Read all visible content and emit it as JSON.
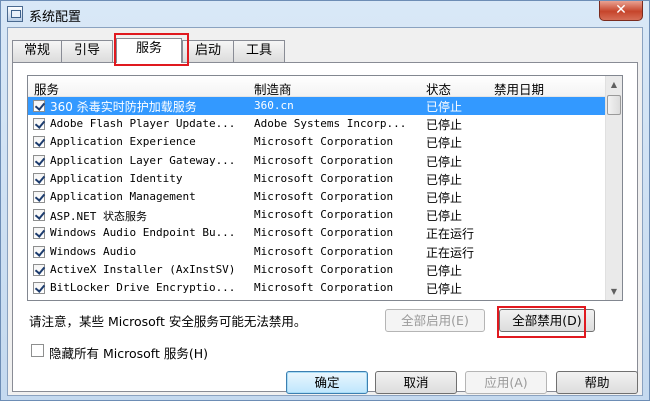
{
  "window": {
    "title": "系统配置",
    "close_symbol": "✕"
  },
  "tabs": [
    {
      "label": "常规"
    },
    {
      "label": "引导"
    },
    {
      "label": "服务"
    },
    {
      "label": "启动"
    },
    {
      "label": "工具"
    }
  ],
  "active_tab": "服务",
  "table": {
    "columns": [
      "服务",
      "制造商",
      "状态",
      "禁用日期"
    ],
    "rows": [
      {
        "name": "360 杀毒实时防护加载服务",
        "manufacturer": "360.cn",
        "status": "已停止",
        "checked": true,
        "selected": true
      },
      {
        "name": "Adobe Flash Player Update...",
        "manufacturer": "Adobe Systems Incorp...",
        "status": "已停止",
        "checked": true
      },
      {
        "name": "Application Experience",
        "manufacturer": "Microsoft Corporation",
        "status": "已停止",
        "checked": true
      },
      {
        "name": "Application Layer Gateway...",
        "manufacturer": "Microsoft Corporation",
        "status": "已停止",
        "checked": true
      },
      {
        "name": "Application Identity",
        "manufacturer": "Microsoft Corporation",
        "status": "已停止",
        "checked": true
      },
      {
        "name": "Application Management",
        "manufacturer": "Microsoft Corporation",
        "status": "已停止",
        "checked": true
      },
      {
        "name": "ASP.NET 状态服务",
        "manufacturer": "Microsoft Corporation",
        "status": "已停止",
        "checked": true
      },
      {
        "name": "Windows Audio Endpoint Bu...",
        "manufacturer": "Microsoft Corporation",
        "status": "正在运行",
        "checked": true
      },
      {
        "name": "Windows Audio",
        "manufacturer": "Microsoft Corporation",
        "status": "正在运行",
        "checked": true
      },
      {
        "name": "ActiveX Installer (AxInstSV)",
        "manufacturer": "Microsoft Corporation",
        "status": "已停止",
        "checked": true
      },
      {
        "name": "BitLocker Drive Encryptio...",
        "manufacturer": "Microsoft Corporation",
        "status": "已停止",
        "checked": true
      }
    ]
  },
  "notice": "请注意，某些 Microsoft 安全服务可能无法禁用。",
  "buttons": {
    "enable_all": "全部启用(E)",
    "disable_all": "全部禁用(D)",
    "ok": "确定",
    "cancel": "取消",
    "apply": "应用(A)",
    "help": "帮助"
  },
  "hide_ms_label": "隐藏所有 Microsoft 服务(H)",
  "scroll": {
    "up": "▲",
    "down": "▼"
  }
}
